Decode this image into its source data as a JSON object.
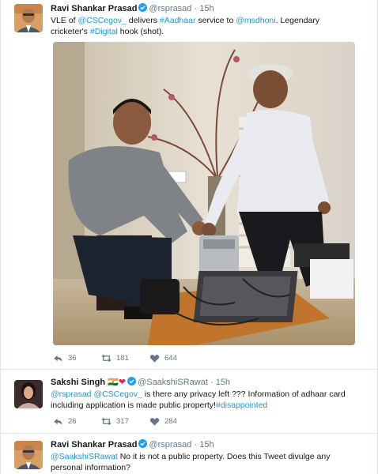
{
  "tweets": [
    {
      "name": "Ravi Shankar Prasad",
      "handle": "@rsprasad",
      "time": "15h",
      "text": {
        "p1": "VLE of ",
        "m1": "@CSCegov_",
        "p2": " delivers ",
        "h1": "#Aadhaar",
        "p3": " service to ",
        "m2": "@msdhoni",
        "p4": ". Legendary",
        "p5": "cricketer's ",
        "h2": "#Digital",
        "p6": " hook (shot)."
      },
      "replies": "36",
      "retweets": "181",
      "likes": "644"
    },
    {
      "name": "Sakshi Singh",
      "flag_emoji": "🇮🇳",
      "heart_emoji": "❤",
      "handle": "@SaakshiSRawat",
      "time": "15h",
      "text": {
        "m1": "@rsprasad",
        "m2": "@CSCegov_",
        "p1": " is there any privacy left ??? Information of adhaar card",
        "p2": "including application is made public property!",
        "h1": "#disappointed"
      },
      "replies": "26",
      "retweets": "317",
      "likes": "284"
    },
    {
      "name": "Ravi Shankar Prasad",
      "handle": "@rsprasad",
      "time": "15h",
      "text": {
        "m1": "@SaakshiSRawat",
        "p1": " No it is not a public property. Does this Tweet divulge any",
        "p2": "personal information?"
      }
    }
  ],
  "separator": "·",
  "colors": {
    "link": "#1b95e0",
    "verified": "#1da1f2",
    "meta": "#657786",
    "heart": "#e0245e"
  },
  "icons": [
    "verified-badge-icon",
    "reply-icon",
    "retweet-icon",
    "like-icon"
  ]
}
